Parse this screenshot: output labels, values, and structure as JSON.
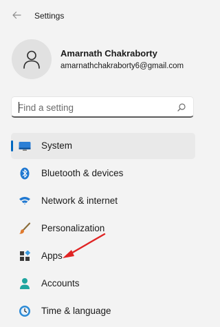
{
  "window": {
    "title": "Settings"
  },
  "profile": {
    "name": "Amarnath Chakraborty",
    "email": "amarnathchakraborty6@gmail.com"
  },
  "search": {
    "placeholder": "Find a setting"
  },
  "nav": {
    "items": [
      {
        "label": "System",
        "icon": "system-icon",
        "selected": true
      },
      {
        "label": "Bluetooth & devices",
        "icon": "bluetooth-icon"
      },
      {
        "label": "Network & internet",
        "icon": "wifi-icon"
      },
      {
        "label": "Personalization",
        "icon": "brush-icon"
      },
      {
        "label": "Apps",
        "icon": "apps-icon"
      },
      {
        "label": "Accounts",
        "icon": "accounts-icon"
      },
      {
        "label": "Time & language",
        "icon": "time-language-icon"
      }
    ]
  },
  "colors": {
    "accent": "#0067c0",
    "annotation_arrow": "#e02424",
    "background": "#f3f3f3",
    "selected_item": "#e9e9e9"
  }
}
